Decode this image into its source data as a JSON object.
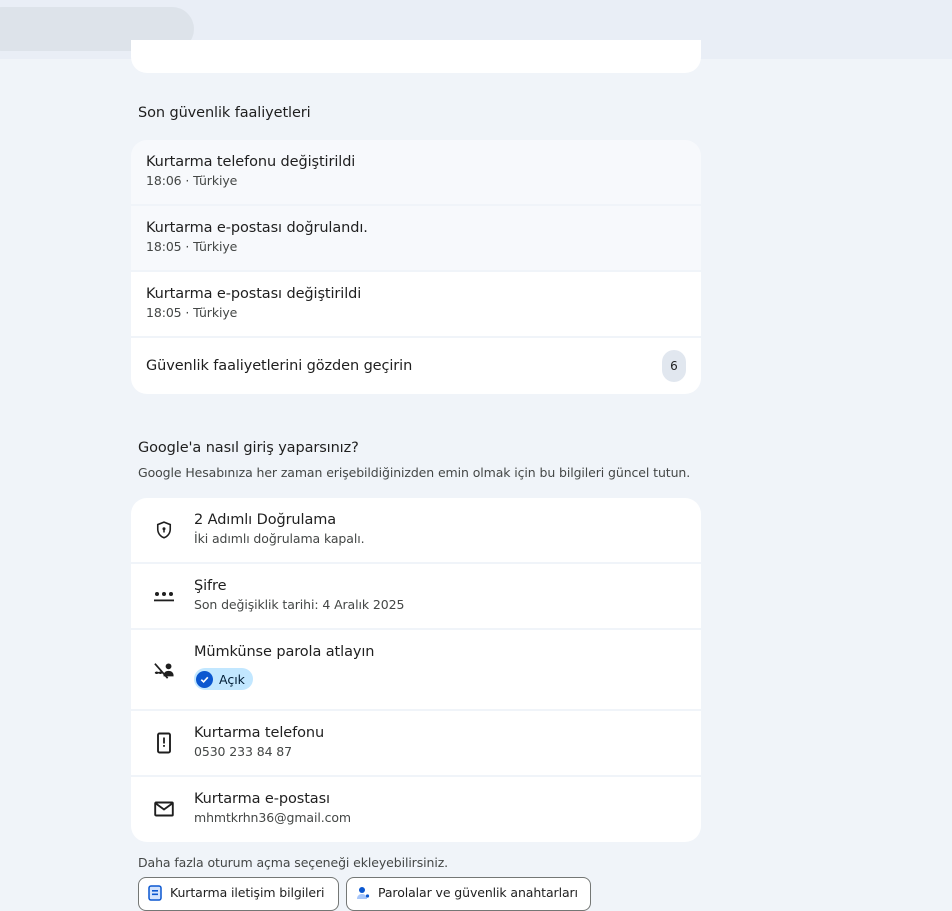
{
  "activity": {
    "title": "Son güvenlik faaliyetleri",
    "items": [
      {
        "title": "Kurtarma telefonu değiştirildi",
        "subtitle": "18:06 · Türkiye"
      },
      {
        "title": "Kurtarma e-postası doğrulandı.",
        "subtitle": "18:05 · Türkiye"
      },
      {
        "title": "Kurtarma e-postası değiştirildi",
        "subtitle": "18:05 · Türkiye"
      }
    ],
    "review_label": "Güvenlik faaliyetlerini gözden geçirin",
    "review_count": "6"
  },
  "signin": {
    "title": "Google'a nasıl giriş yaparsınız?",
    "subtitle": "Google Hesabınıza her zaman erişebildiğinizden emin olmak için bu bilgileri güncel tutun.",
    "items": [
      {
        "icon": "shield-lock-icon",
        "title": "2 Adımlı Doğrulama",
        "subtitle": "İki adımlı doğrulama kapalı."
      },
      {
        "icon": "password-dots-icon",
        "title": "Şifre",
        "subtitle": "Son değişiklik tarihi: 4 Aralık 2025"
      },
      {
        "icon": "passkey-skip-icon",
        "title": "Mümkünse parola atlayın",
        "chip": "Açık"
      },
      {
        "icon": "phone-icon",
        "title": "Kurtarma telefonu",
        "subtitle": "0530 233 84 87"
      },
      {
        "icon": "mail-icon",
        "title": "Kurtarma e-postası",
        "subtitle": "mhmtkrhn36@gmail.com"
      }
    ]
  },
  "more": {
    "text": "Daha fazla oturum açma seçeneği ekleyebilirsiniz.",
    "buttons": [
      {
        "label": "Kurtarma iletişim bilgileri",
        "icon": "contact-card-icon"
      },
      {
        "label": "Parolalar ve güvenlik anahtarları",
        "icon": "passkey-person-icon"
      }
    ]
  },
  "colors": {
    "background": "#f0f4f9",
    "card": "#ffffff",
    "chip_bg": "#c2e7ff",
    "chip_check": "#0b57d0",
    "accent_icon": "#0b57d0"
  }
}
